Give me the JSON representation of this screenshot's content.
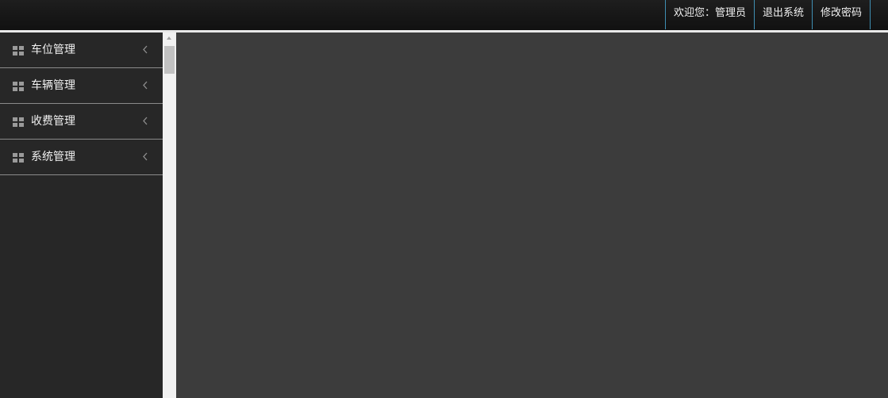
{
  "header": {
    "welcome": "欢迎您：管理员",
    "logout": "退出系统",
    "change_password": "修改密码"
  },
  "sidebar": {
    "items": [
      {
        "label": "车位管理",
        "icon": "grid-icon"
      },
      {
        "label": "车辆管理",
        "icon": "grid-icon"
      },
      {
        "label": "收费管理",
        "icon": "grid-icon"
      },
      {
        "label": "系统管理",
        "icon": "grid-icon"
      }
    ]
  },
  "colors": {
    "topbar": "#151515",
    "sidebar": "#272727",
    "content": "#3c3c3c",
    "accent_border": "#3f8fb3",
    "divider": "#8a8a8a"
  }
}
